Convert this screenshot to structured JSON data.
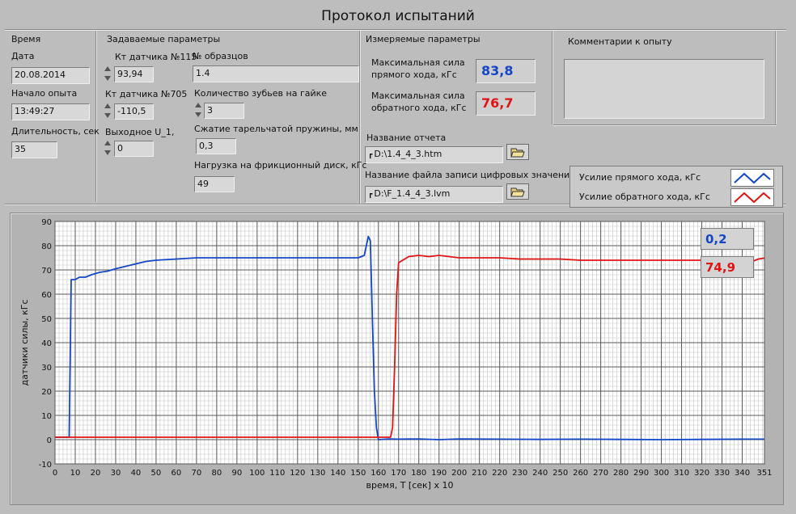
{
  "window": {
    "title": "Протокол испытаний"
  },
  "time_section": {
    "header": "Время",
    "date_label": "Дата",
    "date_value": "20.08.2014",
    "start_label": "Начало опыта",
    "start_value": "13:49:27",
    "duration_label": "Длительность, сек",
    "duration_value": "35"
  },
  "set_params": {
    "header": "Задаваемые параметры",
    "k115_label": "Кт датчика №115",
    "k115_value": "93,94",
    "k705_label": "Кт датчика №705",
    "k705_value": "-110,5",
    "u1_label": "Выходное U_1,",
    "u1_value": "0",
    "samples_label": "№ образцов",
    "samples_value": "1.4",
    "teeth_label": "Количество зубьев на гайке",
    "teeth_value": "3",
    "spring_label": "Сжатие тарельчатой пружины, мм",
    "spring_value": "0,3",
    "load_label": "Нагрузка на фрикционный диск, кГс",
    "load_value": "49"
  },
  "measured": {
    "header": "Измеряемые параметры",
    "max_forward_label_1": "Максимальная сила",
    "max_forward_label_2": "прямого хода, кГс",
    "max_forward_value": "83,8",
    "max_reverse_label_1": "Максимальная сила",
    "max_reverse_label_2": "обратного хода, кГс",
    "max_reverse_value": "76,7",
    "report_label": "Название отчета",
    "report_path": "D:\\1.4_4_3.htm",
    "datafile_label": "Название файла записи цифровых значений",
    "datafile_path": "D:\\F_1.4_4_3.lvm"
  },
  "comments": {
    "header": "Комментарии к опыту",
    "value": ""
  },
  "legend": {
    "forward": "Усилие прямого хода, кГс",
    "reverse": "Усилие обратного хода, кГс"
  },
  "cursor": {
    "forward_value": "0,2",
    "reverse_value": "74,9"
  },
  "colors": {
    "forward": "#1446c8",
    "reverse": "#e01414",
    "grid": "#5a5a5a"
  },
  "icons": {
    "browse": "folder-open-icon",
    "path": "path-icon",
    "spinner": "up-down-arrows-icon"
  },
  "chart_data": {
    "type": "line",
    "xlabel": "время, T [сек] x 10",
    "ylabel": "датчики силы, кГс",
    "xlim": [
      0,
      351
    ],
    "ylim": [
      -10,
      90
    ],
    "xticks": [
      0,
      10,
      20,
      30,
      40,
      50,
      60,
      70,
      80,
      90,
      100,
      110,
      120,
      130,
      140,
      150,
      160,
      170,
      180,
      190,
      200,
      210,
      220,
      230,
      240,
      250,
      260,
      270,
      280,
      290,
      300,
      310,
      320,
      330,
      340,
      351
    ],
    "yticks": [
      -10,
      0,
      10,
      20,
      30,
      40,
      50,
      60,
      70,
      80,
      90
    ],
    "grid": true,
    "series": [
      {
        "name": "Усилие прямого хода, кГс",
        "color": "#1446c8",
        "points": [
          [
            0,
            1
          ],
          [
            7,
            1
          ],
          [
            8,
            66
          ],
          [
            10,
            66
          ],
          [
            12,
            67
          ],
          [
            15,
            67
          ],
          [
            18,
            68
          ],
          [
            22,
            69
          ],
          [
            26,
            69.5
          ],
          [
            30,
            70.5
          ],
          [
            35,
            71.5
          ],
          [
            40,
            72.5
          ],
          [
            45,
            73.5
          ],
          [
            50,
            74
          ],
          [
            60,
            74.5
          ],
          [
            70,
            75
          ],
          [
            80,
            75
          ],
          [
            90,
            75
          ],
          [
            100,
            75
          ],
          [
            110,
            75
          ],
          [
            120,
            75
          ],
          [
            130,
            75
          ],
          [
            140,
            75
          ],
          [
            150,
            75
          ],
          [
            153,
            76
          ],
          [
            155,
            83.8
          ],
          [
            156,
            82
          ],
          [
            157,
            50
          ],
          [
            158,
            20
          ],
          [
            159,
            5
          ],
          [
            160,
            0
          ],
          [
            165,
            0.3
          ],
          [
            170,
            0.2
          ],
          [
            180,
            0.3
          ],
          [
            190,
            0
          ],
          [
            200,
            0.3
          ],
          [
            220,
            0.2
          ],
          [
            240,
            0.1
          ],
          [
            260,
            0.2
          ],
          [
            280,
            0.1
          ],
          [
            300,
            0
          ],
          [
            320,
            0.1
          ],
          [
            340,
            0.2
          ],
          [
            351,
            0.2
          ]
        ]
      },
      {
        "name": "Усилие обратного хода, кГс",
        "color": "#e01414",
        "points": [
          [
            0,
            1
          ],
          [
            20,
            1
          ],
          [
            60,
            1
          ],
          [
            100,
            1
          ],
          [
            140,
            1
          ],
          [
            160,
            1
          ],
          [
            166,
            1
          ],
          [
            167,
            5
          ],
          [
            168,
            30
          ],
          [
            169,
            60
          ],
          [
            170,
            73
          ],
          [
            172,
            74
          ],
          [
            175,
            75.5
          ],
          [
            180,
            76
          ],
          [
            185,
            75.5
          ],
          [
            190,
            76
          ],
          [
            200,
            75
          ],
          [
            210,
            75
          ],
          [
            220,
            75
          ],
          [
            230,
            74.5
          ],
          [
            240,
            74.5
          ],
          [
            250,
            74.5
          ],
          [
            260,
            74
          ],
          [
            270,
            74
          ],
          [
            280,
            74
          ],
          [
            290,
            74
          ],
          [
            300,
            74
          ],
          [
            310,
            74
          ],
          [
            320,
            74
          ],
          [
            330,
            74
          ],
          [
            340,
            74
          ],
          [
            345,
            73.5
          ],
          [
            348,
            74.5
          ],
          [
            351,
            74.9
          ]
        ]
      }
    ]
  }
}
